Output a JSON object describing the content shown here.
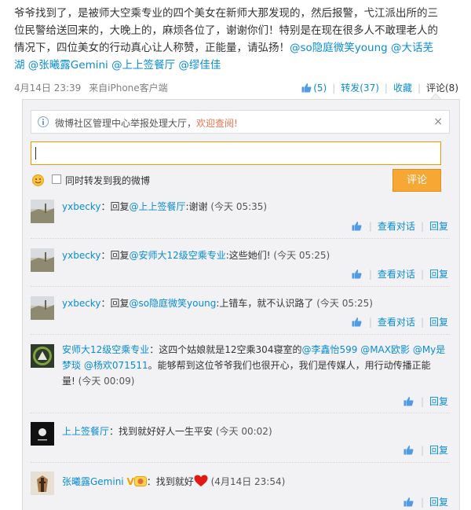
{
  "post": {
    "text_lines": [
      "爷爷找到了，是被师大空乘专业的四个美女在新师大那发现的，然后报警，弋江派出所的三",
      "位民警给送回来的，大晚上的，麻烦各位了，谢谢你们！特别是在现在很多人不敢理老人的",
      "情况下，四位美女的行动真心让人称赞，正能量，请弘扬！"
    ],
    "mentions": [
      "@so隐庭微笑young",
      "@大话芜",
      "湖",
      "@张曦露Gemini",
      "@上上签餐厅",
      "@缪佳佳"
    ],
    "date": "4月14日 23:39",
    "source_prefix": "来自",
    "source": "iPhone客户端",
    "like_count": "(5)",
    "repost_label": "转发(37)",
    "fav_label": "收藏",
    "comment_label": "评论(8)"
  },
  "notice": {
    "text": "微博社区管理中心举报处理大厅，",
    "highlight": "欢迎查阅!",
    "close": "×"
  },
  "composer": {
    "repost_checkbox_label": "同时转发到我的微博",
    "submit_label": "评论"
  },
  "comments": [
    {
      "nick": "yxbecky",
      "text": "：回复",
      "mention": "@上上签餐厅",
      "after": ":谢谢",
      "time": "(今天 05:35)",
      "view": "查看对话",
      "reply": "回复"
    },
    {
      "nick": "yxbecky",
      "text": "：回复",
      "mention": "@安师大12级空乘专业",
      "after": ":这些她们!",
      "time": "(今天 05:25)",
      "view": "查看对话",
      "reply": "回复"
    },
    {
      "nick": "yxbecky",
      "text": "：回复",
      "mention": "@so隐庭微笑young",
      "after": ":上错车，就不认识路了",
      "time": "(今天 05:25)",
      "view": "查看对话",
      "reply": "回复"
    },
    {
      "nick": "安师大12级空乘专业",
      "text": "：这四个姑娘就是12空乘304寝室的",
      "m1": "@李鑫怡599",
      "m2": "@MAX欧影",
      "m3": "@My是",
      "m4": "梦琰",
      "m5": "@杨欢071511",
      "after": "。能够帮到这位爷爷我们也很开心，我们是传媒人，用行动传播正能",
      "after2": "量!",
      "time": "(今天 00:09)",
      "reply": "回复"
    },
    {
      "nick": "上上签餐厅",
      "text": "：找到就好好人一生平安",
      "time": "(今天 00:02)",
      "reply": "回复"
    },
    {
      "nick": "张曦露Gemini",
      "vbadge": "V",
      "text": "：找到就好",
      "time": "(4月14日 23:54)",
      "reply": "回复"
    }
  ],
  "colors": {
    "link": "#0a8cd2",
    "accent": "#f7a733",
    "highlight": "#eb7350"
  }
}
